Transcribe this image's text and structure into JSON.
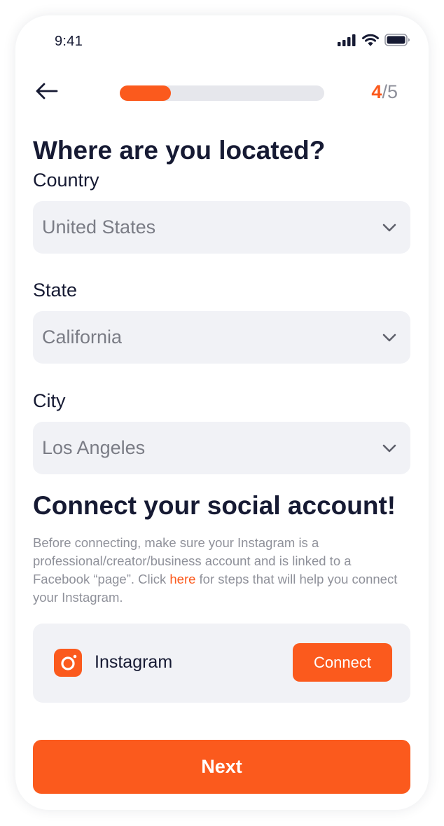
{
  "status_bar": {
    "time": "9:41",
    "icons": [
      "signal-icon",
      "wifi-icon",
      "battery-icon"
    ]
  },
  "header": {
    "back_icon": "arrow-left-icon",
    "progress": {
      "current": 4,
      "total": 5,
      "fraction": 0.25
    },
    "step_current": "4",
    "step_separator": "/",
    "step_total": "5"
  },
  "location": {
    "title": "Where are you located?",
    "country_label": "Country",
    "country_value": "United States",
    "state_label": "State",
    "state_value": "California",
    "city_label": "City",
    "city_value": "Los Angeles",
    "dropdown_icon": "chevron-down-icon"
  },
  "social": {
    "title": "Connect your social account!",
    "description_before": "Before connecting, make sure your Instagram is a professional/creator/business account and is linked to a Facebook “page”. Click ",
    "description_link": "here",
    "description_after": " for steps that will help you connect your Instagram.",
    "instagram": {
      "icon": "instagram-icon",
      "name": "Instagram",
      "connect_label": "Connect"
    }
  },
  "footer": {
    "next_label": "Next"
  },
  "colors": {
    "accent": "#fb5a1d",
    "text_dark": "#161a33",
    "text_muted": "#8f919a",
    "field_bg": "#f1f2f6",
    "track_bg": "#e6e7ec"
  }
}
